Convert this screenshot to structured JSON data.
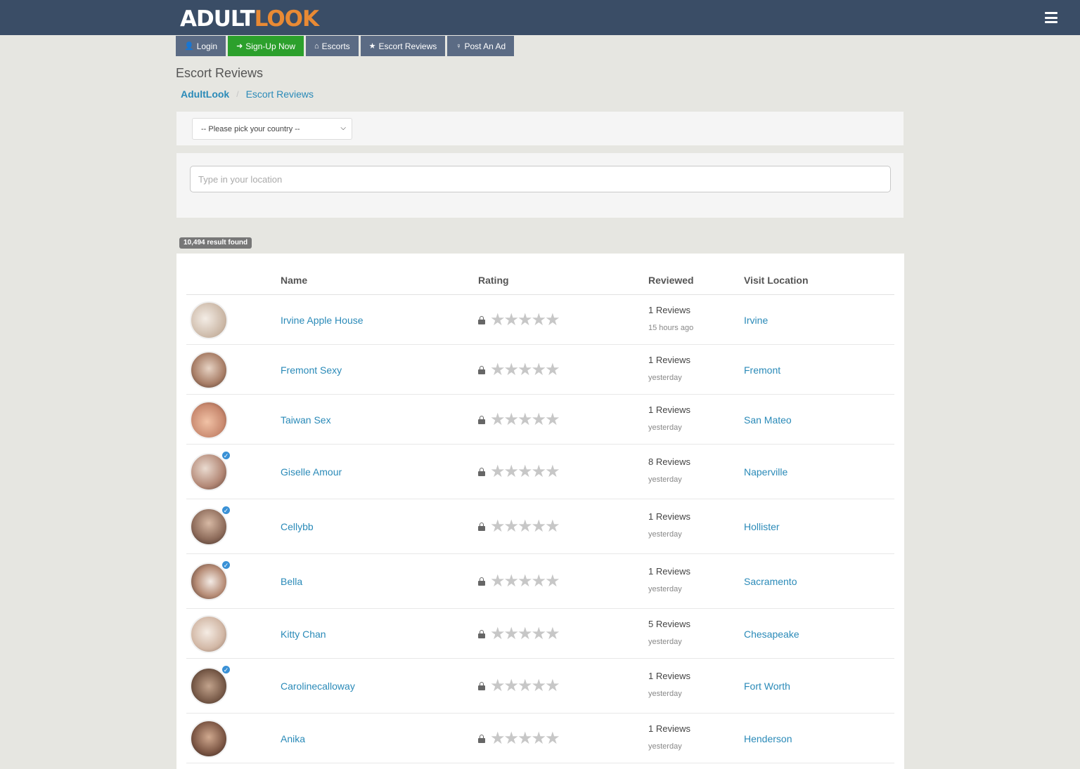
{
  "header": {
    "logo_part1": "ADULT",
    "logo_part2": "LOOK",
    "menu_icon": "hamburger-icon"
  },
  "nav": [
    {
      "label": "Login",
      "icon": "user-icon",
      "glyph": "👤"
    },
    {
      "label": "Sign-Up Now",
      "icon": "sign-in-icon",
      "glyph": "➜"
    },
    {
      "label": "Escorts",
      "icon": "home-icon",
      "glyph": "⌂"
    },
    {
      "label": "Escort Reviews",
      "icon": "star-icon",
      "glyph": "★"
    },
    {
      "label": "Post An Ad",
      "icon": "female-icon",
      "glyph": "♀"
    }
  ],
  "page": {
    "title": "Escort Reviews",
    "breadcrumb_home": "AdultLook",
    "breadcrumb_current": "Escort Reviews"
  },
  "filters": {
    "country_select": "-- Please pick your country --",
    "location_placeholder": "Type in your location"
  },
  "results": {
    "count_label": "10,494 result found",
    "columns": [
      "Name",
      "Rating",
      "Reviewed",
      "Visit Location"
    ],
    "rows": [
      {
        "name": "Irvine Apple House",
        "reviews": "1 Reviews",
        "when": "15 hours ago",
        "location": "Irvine",
        "verified": false,
        "rating_stars": 0
      },
      {
        "name": "Fremont Sexy",
        "reviews": "1 Reviews",
        "when": "yesterday",
        "location": "Fremont",
        "verified": false,
        "rating_stars": 0
      },
      {
        "name": "Taiwan Sex",
        "reviews": "1 Reviews",
        "when": "yesterday",
        "location": "San Mateo",
        "verified": false,
        "rating_stars": 0
      },
      {
        "name": "Giselle Amour",
        "reviews": "8 Reviews",
        "when": "yesterday",
        "location": "Naperville",
        "verified": true,
        "rating_stars": 0
      },
      {
        "name": "Cellybb",
        "reviews": "1 Reviews",
        "when": "yesterday",
        "location": "Hollister",
        "verified": true,
        "rating_stars": 0
      },
      {
        "name": "Bella",
        "reviews": "1 Reviews",
        "when": "yesterday",
        "location": "Sacramento",
        "verified": true,
        "rating_stars": 0
      },
      {
        "name": "Kitty Chan",
        "reviews": "5 Reviews",
        "when": "yesterday",
        "location": "Chesapeake",
        "verified": false,
        "rating_stars": 0
      },
      {
        "name": "Carolinecalloway",
        "reviews": "1 Reviews",
        "when": "yesterday",
        "location": "Fort Worth",
        "verified": true,
        "rating_stars": 0
      },
      {
        "name": "Anika",
        "reviews": "1 Reviews",
        "when": "yesterday",
        "location": "Henderson",
        "verified": false,
        "rating_stars": 0
      }
    ]
  },
  "colors": {
    "topbar": "#3a4d66",
    "logo_accent": "#e98a34",
    "nav_button": "#5b6b84",
    "signup_button": "#2ca02c",
    "link": "#2a8ab8",
    "star_empty": "#c7c7c7",
    "verified": "#3a91d6"
  }
}
